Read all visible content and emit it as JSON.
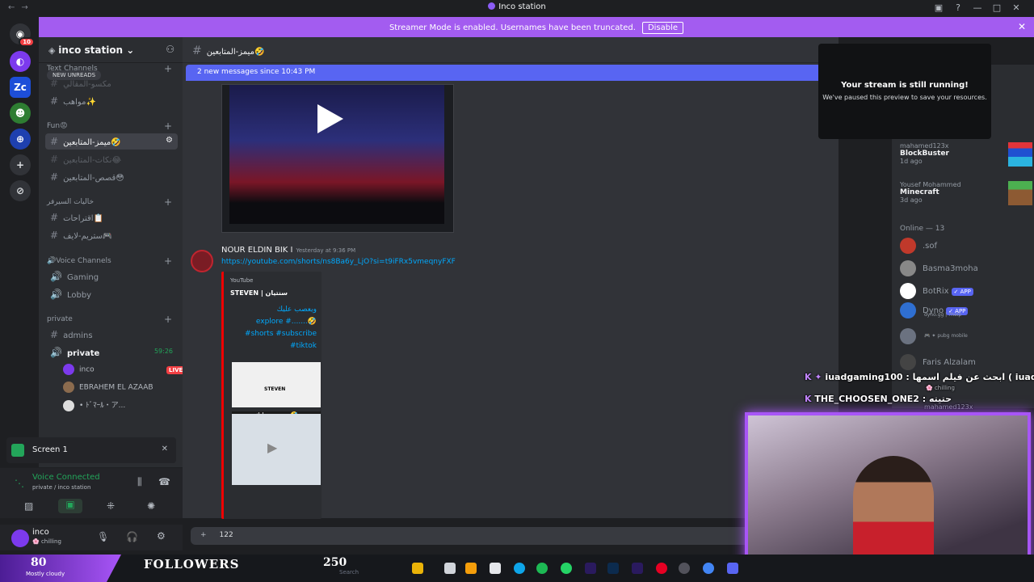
{
  "window": {
    "title": "Inco station"
  },
  "notice": {
    "text": "Streamer Mode is enabled. Usernames have been truncated.",
    "disable_label": "Disable"
  },
  "server": {
    "name": "inco station"
  },
  "guild_badge": "10",
  "guild_zc": "Zc",
  "unread_pill": "NEW UNREADS",
  "categories": {
    "text": "Text Channels",
    "fun": "Fun😡",
    "fun2": "خاليات السيرفر",
    "voice": "Voice Channels",
    "private": "private"
  },
  "channels": {
    "c1": "مكسو-المقالي",
    "c2": "مواهب✨",
    "fun_active": "ميمز-المتابعين🤣",
    "fun_b": "نكات-المتابعين😂",
    "fun_c": "قصص-المتابعين😳",
    "x1": "اقتراحات📋",
    "x2": "ستريم-لايف🎮",
    "gaming": "Gaming",
    "lobby": "Lobby",
    "admins": "admins",
    "private_voice": "private",
    "private_timer": "59:26"
  },
  "voice_users": [
    {
      "name": "inco",
      "live": "LIVE"
    },
    {
      "name": "EBRAHEM EL AZAAB"
    },
    {
      "name": "• ﾄﾞﾏｰﾙ・ア..."
    }
  ],
  "screen_panel": {
    "label": "Screen 1"
  },
  "voice_connected": {
    "title": "Voice Connected",
    "sub": "private / inco station"
  },
  "user": {
    "name": "inco",
    "status": "🌸 chilling"
  },
  "chat": {
    "channel": "ميمز-المتابعين🤣",
    "new_messages": "2 new messages since 10:43 PM",
    "author": "NOUR ELDIN BIK I",
    "timestamp": "Yesterday at 9:36 PM",
    "link": "https://youtube.com/shorts/ns8Ba6y_LjO?si=t9iFRx5vmeqnyFXF",
    "embed_provider": "YouTube",
    "embed_title": "STEVEN | سنتيان",
    "embed_desc": [
      "ويعصب عليك",
      "explore #.......🤣",
      "#shorts #subscribe",
      "#tiktok"
    ],
    "img_caption_top": "STEVEN",
    "img_caption": "ويعصب عليك🤣",
    "composer": "122"
  },
  "popup": {
    "title": "Your stream is still running!",
    "sub": "We've paused this preview to save your resources."
  },
  "activities": [
    {
      "user": "mahamed123x",
      "game": "BlockBuster",
      "time": "1d ago"
    },
    {
      "user": "Yousef Mohammed",
      "game": "Minecraft",
      "time": "3d ago"
    }
  ],
  "online_header": "Online — 13",
  "members": [
    {
      "name": ".sof"
    },
    {
      "name": "Basma3moha"
    },
    {
      "name": "BotRix",
      "tag": "✓ APP"
    },
    {
      "name": "Dyno",
      "tag": "✓ APP",
      "sub": "dyno.gg | ?help"
    },
    {
      "name": "",
      "sub": "🎮 ✦ pubg mobile"
    },
    {
      "name": "Faris Alzalam"
    }
  ],
  "overlay_chat": [
    {
      "prefix": "K ✦",
      "text": "iuadgaming100 : ابحث عن فيلم اسمها ( iuad | ابني )"
    },
    {
      "prefix": "K",
      "text": "THE_CHOOSEN_ONE2 : حتيته"
    }
  ],
  "overlay_extra": [
    "🌸 chilling",
    "mahamed123x"
  ],
  "taskbar": {
    "followers_count": "80",
    "followers_label": "FOLLOWERS",
    "goal": "250",
    "weather": "Mostly cloudy",
    "search": "Search"
  },
  "colors": {
    "accent": "#a855f7",
    "blurple": "#5865f2",
    "live": "#f23f43"
  }
}
